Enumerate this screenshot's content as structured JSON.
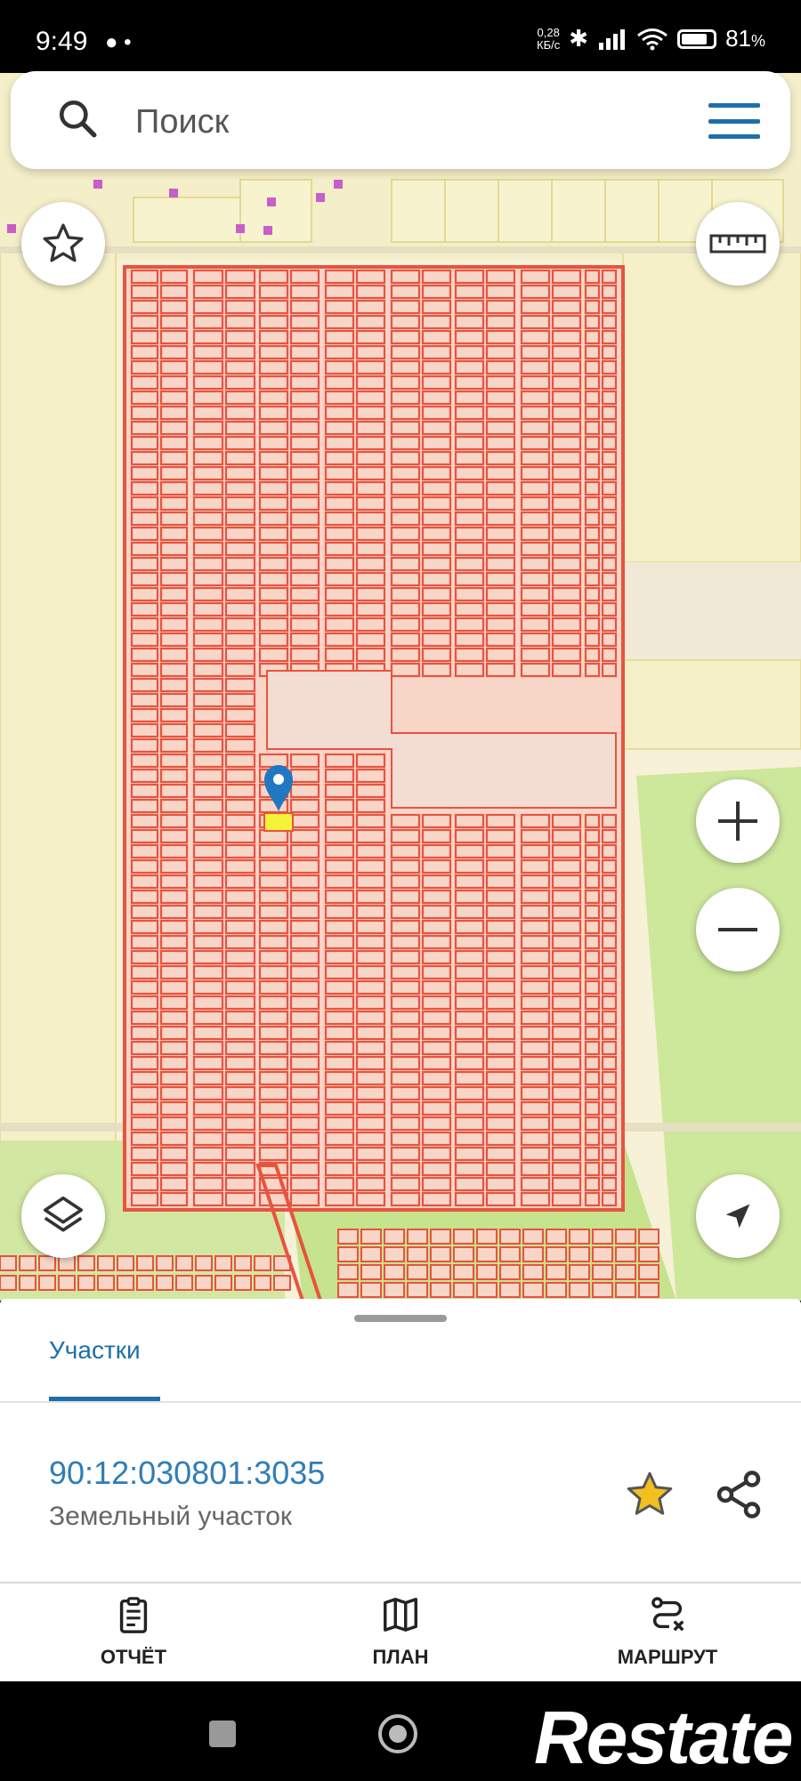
{
  "status_bar": {
    "time": "9:49",
    "net_speed_value": "0,28",
    "net_speed_unit": "КБ/с",
    "battery_percent": "81",
    "battery_suffix": "%"
  },
  "search": {
    "placeholder": "Поиск"
  },
  "map": {
    "plots_color": "#e8533f",
    "plots_fill": "#f7d6c8",
    "background_color": "#f6f1d7",
    "green_area_color": "#cde79b",
    "marker_color": "#1f78c1",
    "selected_plot_color": "#f5f23a"
  },
  "sheet": {
    "tab_label": "Участки",
    "cadastral_number": "90:12:030801:3035",
    "plot_type": "Земельный участок"
  },
  "toolbar": {
    "report_label": "ОТЧЁТ",
    "plan_label": "ПЛАН",
    "route_label": "МАРШРУТ"
  },
  "watermark": {
    "text": "Restate"
  },
  "colors": {
    "accent": "#1f6fa8",
    "link": "#2f7db8",
    "star": "#f2c01e"
  }
}
